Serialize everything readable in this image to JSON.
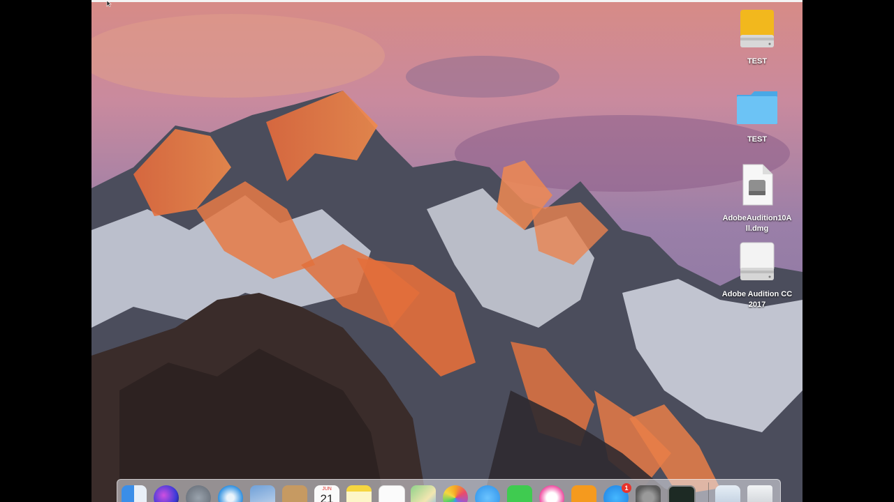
{
  "desktop": {
    "items": [
      {
        "label": "TEST",
        "icon": "external-drive-icon"
      },
      {
        "label": "TEST",
        "icon": "folder-icon"
      },
      {
        "label": "AdobeAudition10All.dmg",
        "label_line1": "AdobeAudition10A",
        "label_line2": "ll.dmg",
        "icon": "disk-image-icon"
      },
      {
        "label": "Adobe Audition CC 2017",
        "label_line1": "Adobe Audition CC",
        "label_line2": "2017",
        "icon": "mounted-volume-icon"
      }
    ]
  },
  "dock": {
    "apps": [
      {
        "name": "Finder",
        "icon": "finder-icon"
      },
      {
        "name": "Siri",
        "icon": "siri-icon"
      },
      {
        "name": "Launchpad",
        "icon": "launchpad-icon"
      },
      {
        "name": "Safari",
        "icon": "safari-icon"
      },
      {
        "name": "Mail",
        "icon": "mail-icon"
      },
      {
        "name": "Contacts",
        "icon": "contacts-icon"
      },
      {
        "name": "Calendar",
        "icon": "calendar-icon",
        "month": "JUN",
        "day": "21"
      },
      {
        "name": "Notes",
        "icon": "notes-icon"
      },
      {
        "name": "Reminders",
        "icon": "reminders-icon"
      },
      {
        "name": "Maps",
        "icon": "maps-icon"
      },
      {
        "name": "Photos",
        "icon": "photos-icon"
      },
      {
        "name": "Messages",
        "icon": "messages-icon"
      },
      {
        "name": "FaceTime",
        "icon": "facetime-icon"
      },
      {
        "name": "iTunes",
        "icon": "itunes-icon"
      },
      {
        "name": "iBooks",
        "icon": "ibooks-icon"
      },
      {
        "name": "App Store",
        "icon": "app-store-icon",
        "badge": "1"
      },
      {
        "name": "System Preferences",
        "icon": "system-preferences-icon"
      },
      {
        "name": "Activity Monitor",
        "icon": "activity-monitor-icon"
      },
      {
        "name": "Downloads",
        "icon": "downloads-stack-icon"
      },
      {
        "name": "Trash",
        "icon": "trash-icon"
      }
    ]
  },
  "colors": {
    "folder": "#5ab8f0",
    "drive": "#f2b81d",
    "badge": "#e8332c"
  }
}
